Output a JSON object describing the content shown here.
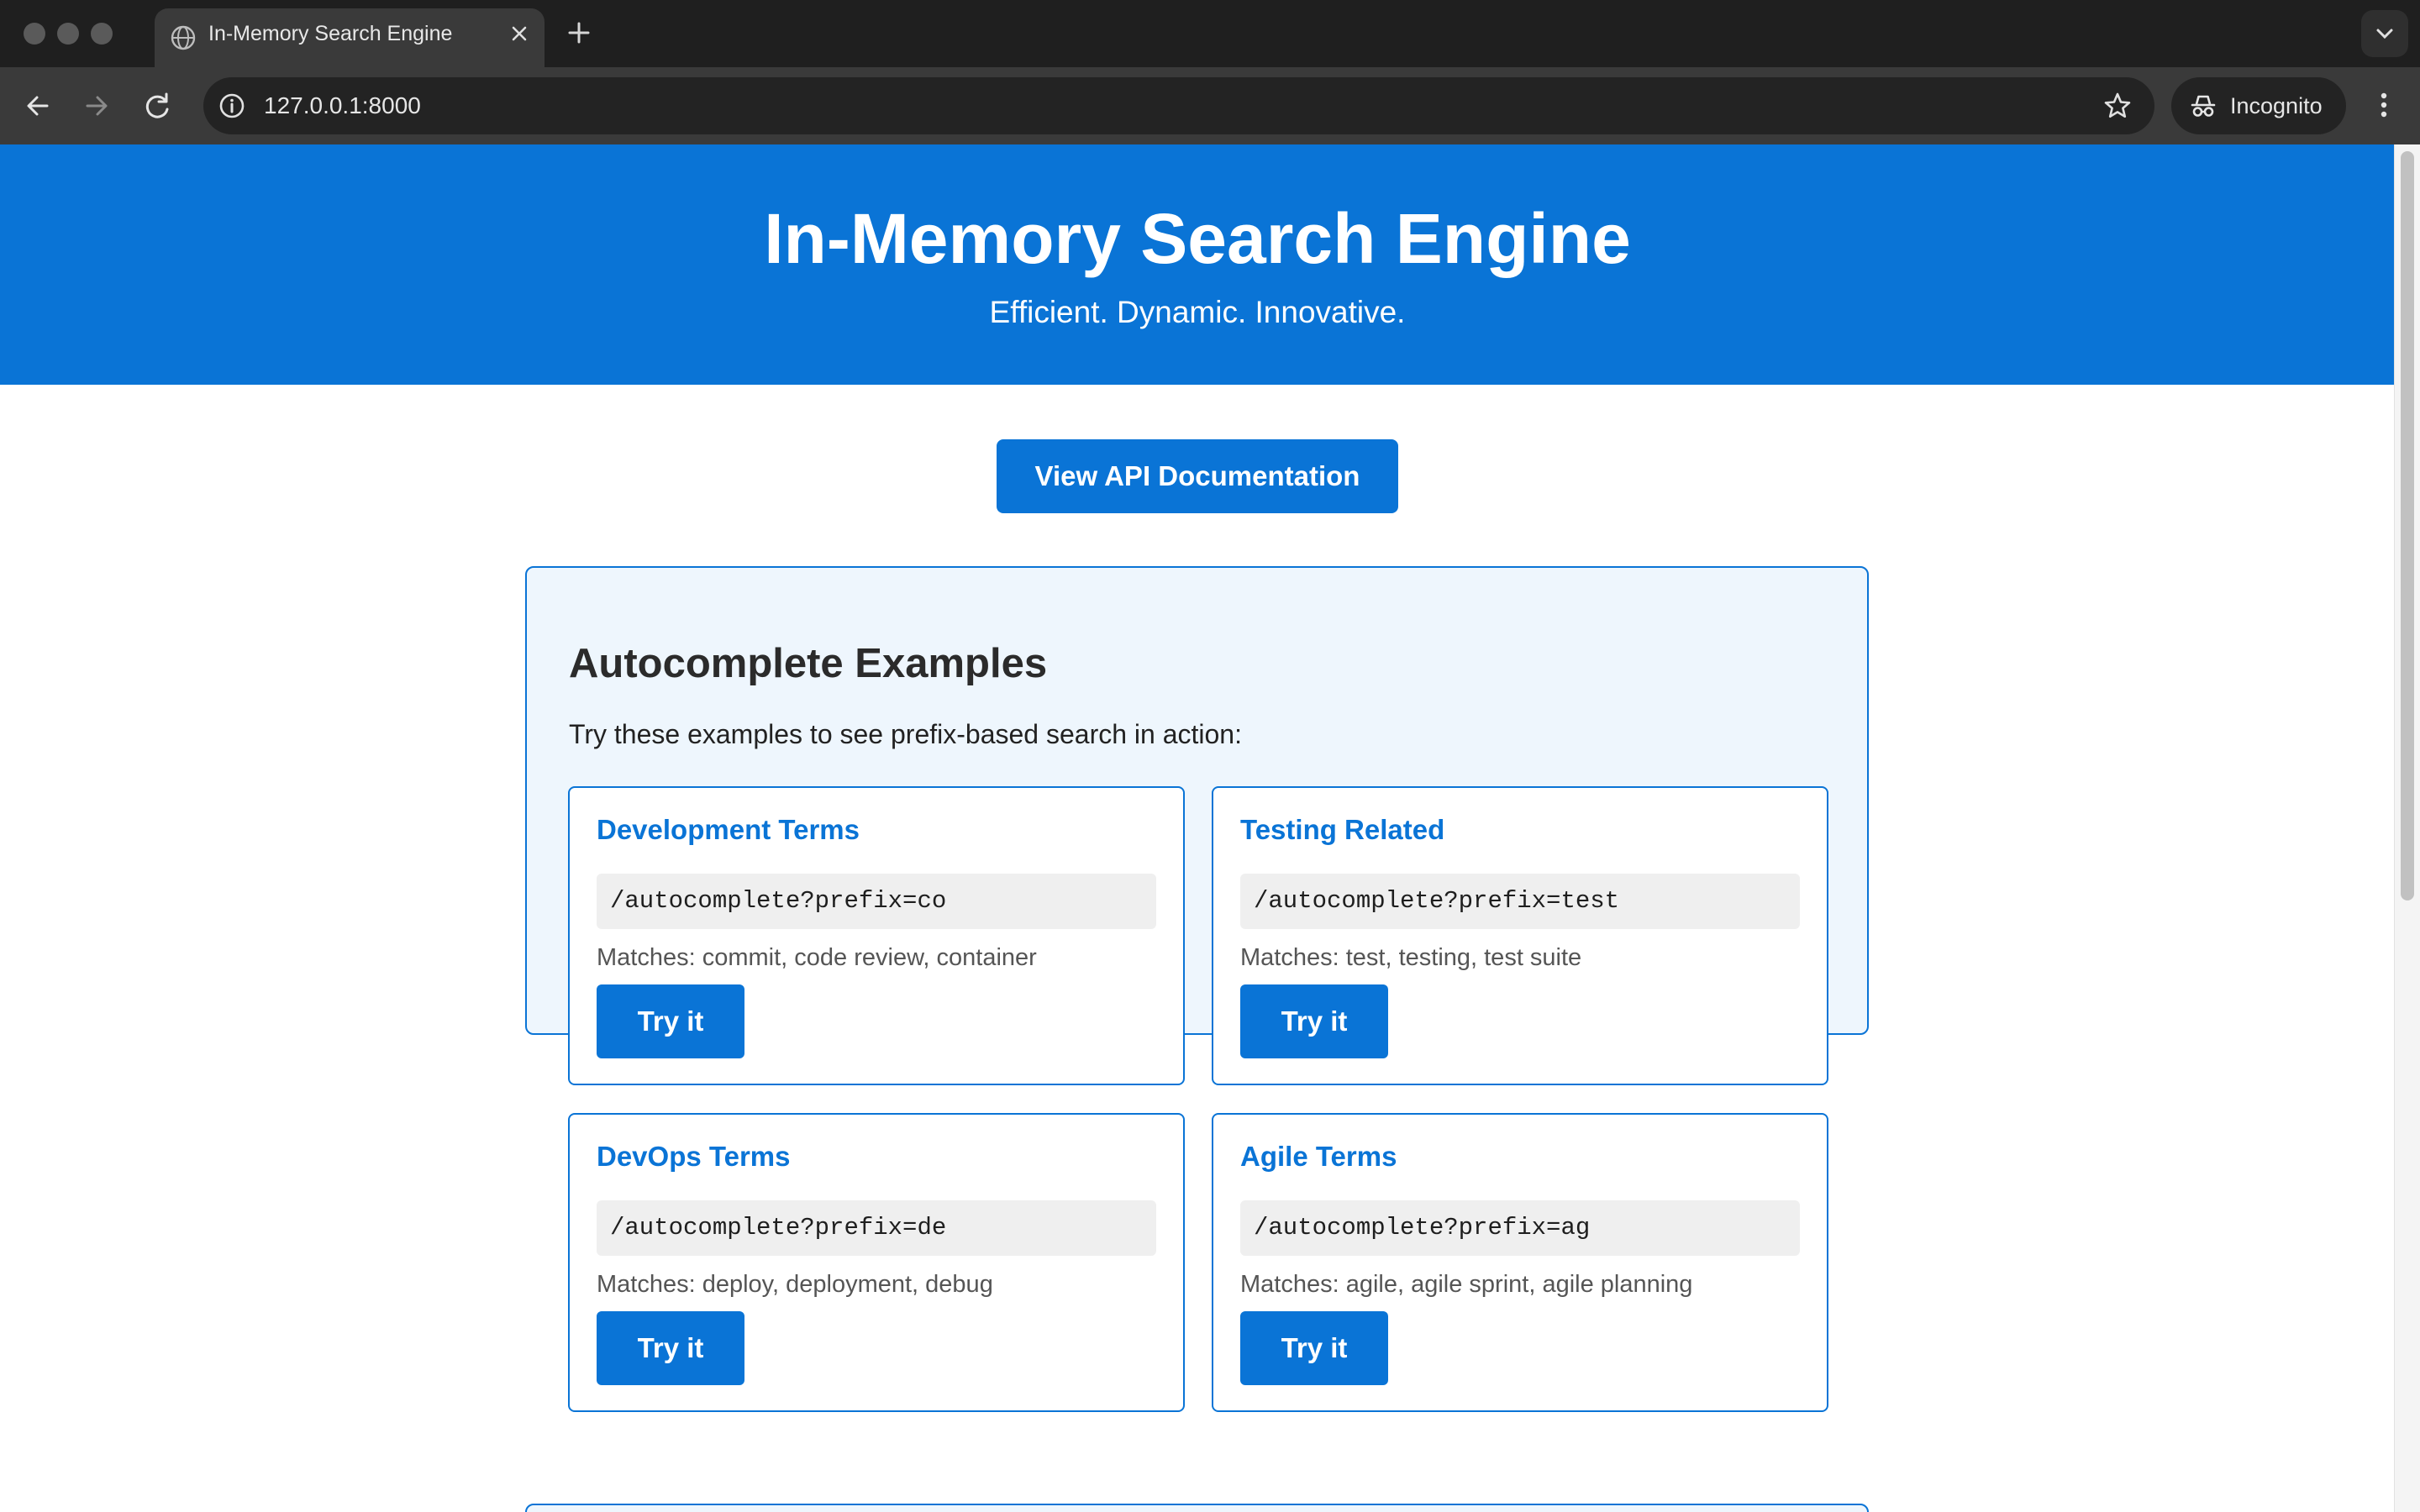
{
  "browser": {
    "tab_title": "In-Memory Search Engine",
    "url": "127.0.0.1:8000",
    "mode_label": "Incognito"
  },
  "hero": {
    "title": "In-Memory Search Engine",
    "subtitle": "Efficient. Dynamic. Innovative.",
    "background_color": "#0a74d6"
  },
  "api_button_label": "View API Documentation",
  "examples": {
    "heading": "Autocomplete Examples",
    "intro": "Try these examples to see prefix-based search in action:",
    "cards": [
      {
        "title": "Development Terms",
        "endpoint": "/autocomplete?prefix=co",
        "matches": "Matches: commit, code review, container",
        "button": "Try it"
      },
      {
        "title": "Testing Related",
        "endpoint": "/autocomplete?prefix=test",
        "matches": "Matches: test, testing, test suite",
        "button": "Try it"
      },
      {
        "title": "DevOps Terms",
        "endpoint": "/autocomplete?prefix=de",
        "matches": "Matches: deploy, deployment, debug",
        "button": "Try it"
      },
      {
        "title": "Agile Terms",
        "endpoint": "/autocomplete?prefix=ag",
        "matches": "Matches: agile, agile sprint, agile planning",
        "button": "Try it"
      }
    ]
  },
  "icons": {
    "tab_favicon": "globe-icon",
    "back": "arrow-left-icon",
    "forward": "arrow-right-icon",
    "reload": "reload-icon",
    "site_info": "info-icon",
    "bookmark": "star-icon",
    "incognito": "incognito-icon",
    "menu": "kebab-menu-icon"
  }
}
